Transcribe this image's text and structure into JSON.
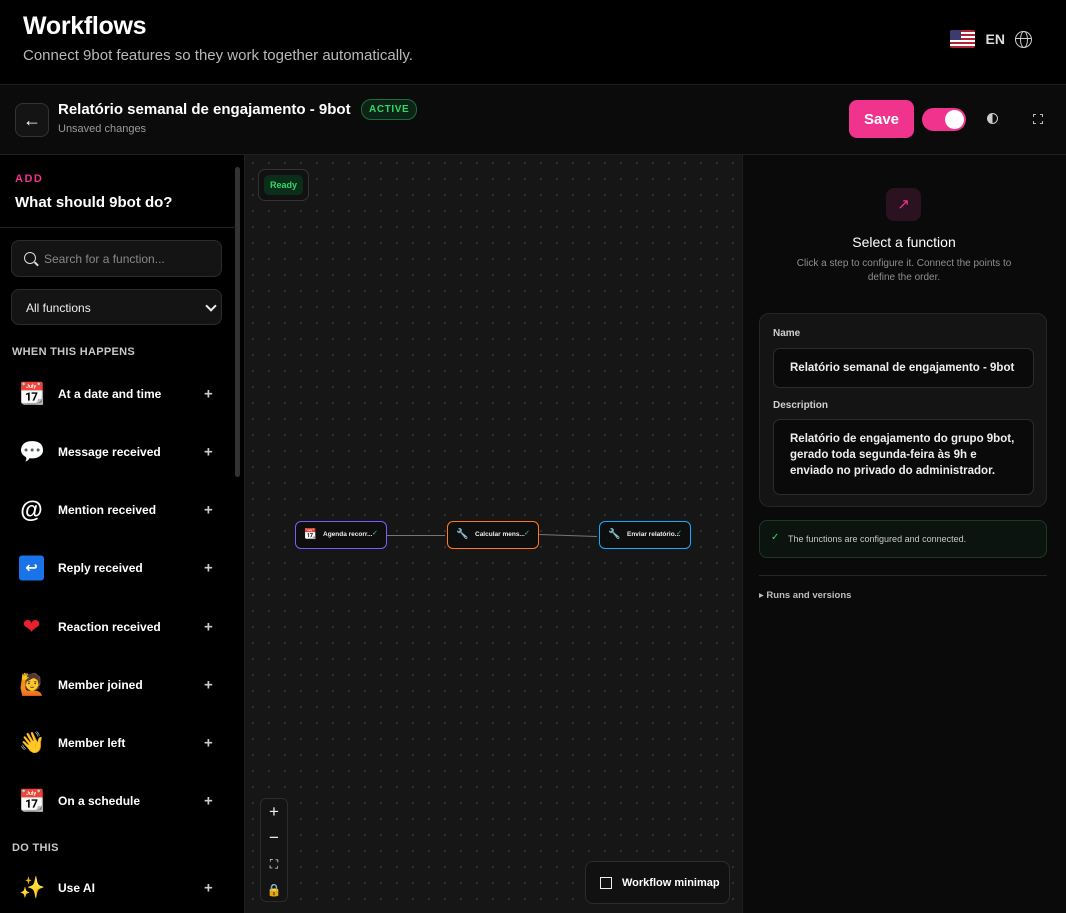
{
  "header": {
    "title": "Workflows",
    "subtitle": "Connect 9bot features so they work together automatically.",
    "language_code": "EN",
    "language_flag": "us-flag-icon"
  },
  "workflow": {
    "name": "Relatório semanal de engajamento - 9bot",
    "status": "ACTIVE",
    "unsaved_note": "Unsaved changes",
    "save_label": "Save",
    "enabled": true,
    "accent_color": "#f0338d"
  },
  "sidebar": {
    "add_label": "ADD",
    "add_title": "What should 9bot do?",
    "search_placeholder": "Search for a function...",
    "filter_selected": "All functions",
    "triggers_header": "WHEN THIS HAPPENS",
    "triggers": [
      {
        "label": "At a date and time",
        "icon": "calendar-icon"
      },
      {
        "label": "Message received",
        "icon": "speech-bubble-icon"
      },
      {
        "label": "Mention received",
        "icon": "at-sign-icon"
      },
      {
        "label": "Reply received",
        "icon": "reply-arrow-icon"
      },
      {
        "label": "Reaction received",
        "icon": "heart-icon"
      },
      {
        "label": "Member joined",
        "icon": "raising-hand-icon"
      },
      {
        "label": "Member left",
        "icon": "waving-hand-icon"
      },
      {
        "label": "On a schedule",
        "icon": "calendar-icon"
      }
    ],
    "actions_header": "DO THIS",
    "actions": [
      {
        "label": "Use AI",
        "icon": "sparkles-icon"
      }
    ]
  },
  "canvas": {
    "status": "Ready",
    "nodes": [
      {
        "label": "Agenda recorr...",
        "icon": "calendar-icon",
        "border": "#7b5cff"
      },
      {
        "label": "Calcular mens...",
        "icon": "tools-icon",
        "border": "#ff7a1a"
      },
      {
        "label": "Enviar relatório...",
        "icon": "tools-icon",
        "border": "#1aa8ff"
      }
    ],
    "minimap_label": "Workflow minimap"
  },
  "panel": {
    "title": "Select a function",
    "hint": "Click a step to configure it. Connect the points to define the order.",
    "name_label": "Name",
    "name_value": "Relatório semanal de engajamento - 9bot",
    "description_label": "Description",
    "description_value": "Relatório de engajamento do grupo 9bot, gerado toda segunda-feira às 9h e enviado no privado do administrador.",
    "status_note": "The functions are configured and connected.",
    "runs_label": "Runs and versions"
  }
}
